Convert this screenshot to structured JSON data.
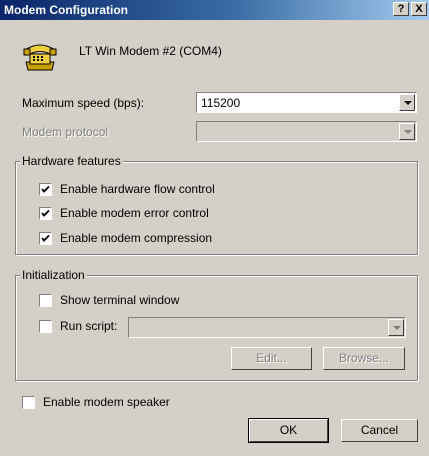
{
  "window": {
    "title": "Modem Configuration",
    "help_glyph": "?",
    "close_glyph": "X"
  },
  "modem": {
    "name": "LT Win Modem #2 (COM4)",
    "icon": "modem-phone-icon"
  },
  "speed": {
    "label": "Maximum speed (bps):",
    "value": "115200"
  },
  "protocol": {
    "label": "Modem protocol",
    "value": ""
  },
  "hardware": {
    "title": "Hardware features",
    "flow_control": {
      "label": "Enable hardware flow control",
      "checked": true
    },
    "error_control": {
      "label": "Enable modem error control",
      "checked": true
    },
    "compression": {
      "label": "Enable modem compression",
      "checked": true
    }
  },
  "init": {
    "title": "Initialization",
    "terminal": {
      "label": "Show terminal window",
      "checked": false
    },
    "script": {
      "label": "Run script:",
      "checked": false,
      "value": ""
    },
    "edit_label": "Edit...",
    "browse_label": "Browse..."
  },
  "speaker": {
    "label": "Enable modem speaker",
    "checked": false
  },
  "buttons": {
    "ok_label": "OK",
    "cancel_label": "Cancel"
  }
}
